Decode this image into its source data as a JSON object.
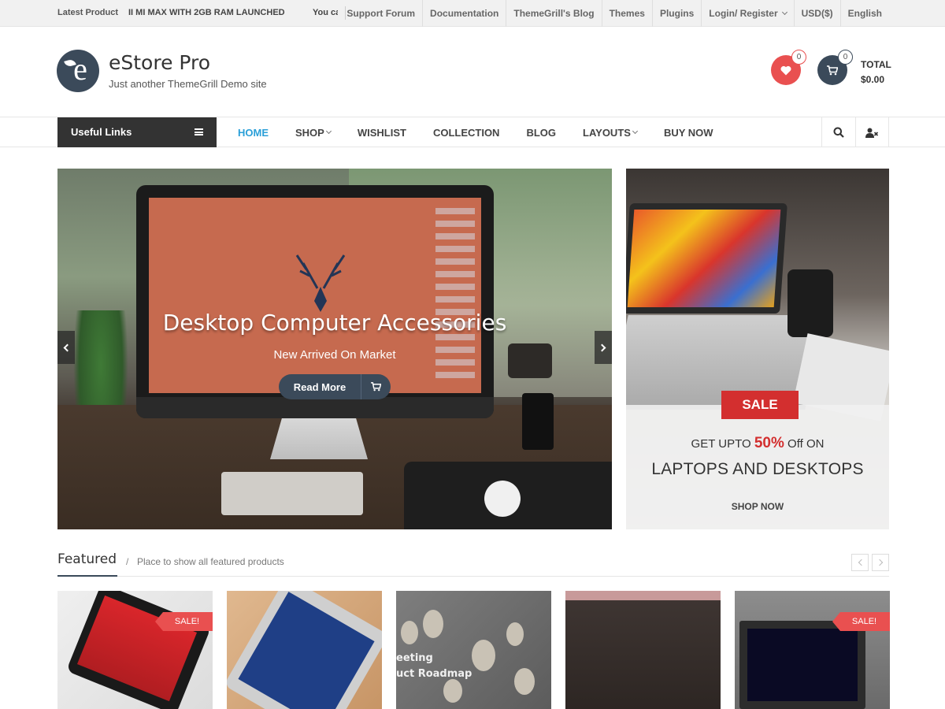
{
  "topbar": {
    "latest_label": "Latest Product",
    "ticker": [
      "II MI MAX WITH 2GB RAM LAUNCHED",
      "You ca"
    ],
    "nav": [
      "Support Forum",
      "Documentation",
      "ThemeGrill's Blog",
      "Themes",
      "Plugins",
      "Login/ Register",
      "USD($)",
      "English"
    ]
  },
  "header": {
    "logo_letter": "e",
    "site_title": "eStore Pro",
    "tagline": "Just another ThemeGrill Demo site",
    "wishlist_count": "0",
    "cart_count": "0",
    "total_label": "TOTAL",
    "total_value": "$0.00"
  },
  "mainnav": {
    "useful_links": "Useful Links",
    "items": [
      "HOME",
      "SHOP",
      "WISHLIST",
      "COLLECTION",
      "BLOG",
      "LAYOUTS",
      "BUY NOW"
    ],
    "active": "HOME",
    "dropdowns": [
      "SHOP",
      "LAYOUTS"
    ]
  },
  "hero": {
    "title": "Desktop Computer Accessories",
    "subtitle": "New Arrived On Market",
    "button": "Read More"
  },
  "promo": {
    "badge": "SALE",
    "line_prefix": "GET UPTO",
    "percent": "50%",
    "line_suffix": "Off ON",
    "headline": "LAPTOPS AND DESKTOPS",
    "cta": "SHOP NOW"
  },
  "featured": {
    "title": "Featured",
    "subtitle": "Place to show all featured products",
    "cards": [
      {
        "sale": "SALE!"
      },
      {
        "sale": ""
      },
      {
        "sale": "",
        "image_text": [
          "eeting",
          "uct Roadmap"
        ]
      },
      {
        "sale": ""
      },
      {
        "sale": "SALE!"
      }
    ]
  },
  "colors": {
    "accent_blue": "#2a9fd8",
    "navy": "#3b4a5a",
    "sale_red": "#d32f2f",
    "wishlist_red": "#e95050"
  }
}
